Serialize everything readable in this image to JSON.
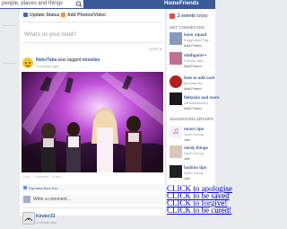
{
  "topbar": {
    "search_placeholder": "people, places and things",
    "home": "Home",
    "friends": "Friends"
  },
  "composer": {
    "update_status": "Update Status",
    "add_photos": "Add Photos/Video",
    "prompt": "What's on your mind?",
    "sort": "SORT ▾"
  },
  "post1": {
    "author": "NekoTaka",
    "action": "was tagged",
    "target": "missilav",
    "time": "2 minutes ago",
    "caption": "Like · Comment · Share"
  },
  "likes": {
    "text": "Flymaria likes this."
  },
  "comment": {
    "placeholder": "Write a comment..."
  },
  "post2": {
    "author": "Kinder33",
    "time": "1 minute ago"
  },
  "sidebar": {
    "events": "2 events",
    "events_suffix": "today",
    "get_connected": "GET CONNECTED",
    "people": [
      {
        "name": "lover squad",
        "sub": "Suggested Pag..."
      },
      {
        "name": "slothgant++",
        "sub": "Friends with ..."
      },
      {
        "name": "how to add cool",
        "sub": "and friends..."
      },
      {
        "name": "fleltacks and more",
        "sub": "rainbowfilozard"
      }
    ],
    "link_add": "Add Friend",
    "suggested": "SUGGESTED GROUPS",
    "groups": [
      {
        "name": "music tips",
        "sub": "Open Group"
      },
      {
        "name": "nerdy things",
        "sub": "Open Group"
      },
      {
        "name": "fashion tips",
        "sub": "Open Group"
      }
    ],
    "join": "Join"
  },
  "overlay": [
    "CLICK to apologise",
    "CLICK to be saved",
    "CLICK to forgive!",
    "CLICK to be cured!"
  ],
  "colors": {
    "brand": "#3b5998",
    "link": "#365899",
    "overlay_link": "#0000cc"
  }
}
